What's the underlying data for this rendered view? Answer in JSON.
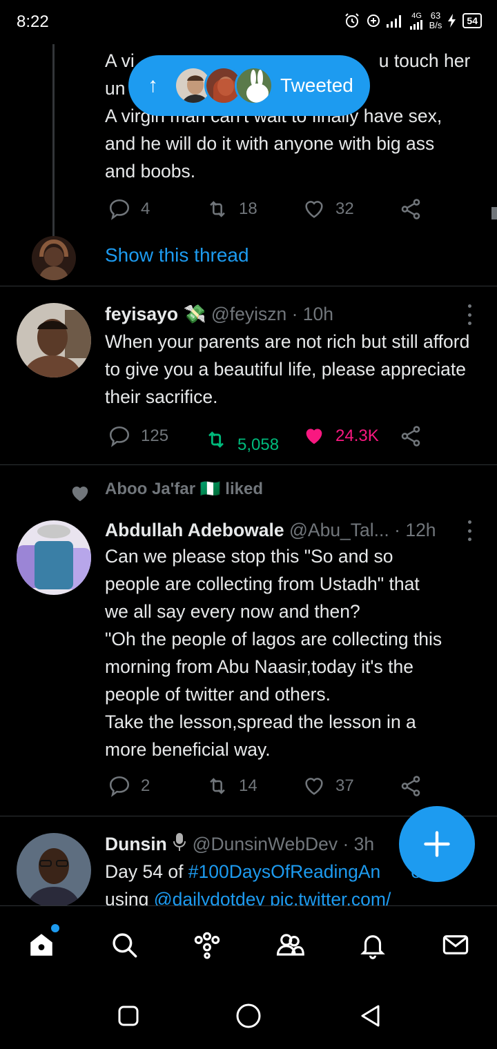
{
  "status_bar": {
    "time": "8:22",
    "network": "4G",
    "net_speed_value": "63",
    "net_speed_unit": "B/s",
    "battery": "54"
  },
  "toast": {
    "label": "Tweeted"
  },
  "thread_tweet": {
    "text_lines": [
      "A virgin woman will cry that you touch her",
      "un",
      "A virgin man can't wait to finally have sex,",
      "and he will do it with anyone with big ass",
      "and boobs."
    ],
    "text_line1_visible_start": "A vi",
    "text_line1_visible_end": "u touch her",
    "replies": "4",
    "retweets": "18",
    "likes": "32",
    "show_thread": "Show this thread"
  },
  "tweets": [
    {
      "name": "feyisayo",
      "name_emoji": "💸",
      "handle": "@feyiszn",
      "time": "· 10h",
      "text": "When your parents are not rich but still afford to give you a beautiful life, please appreciate their sacrifice.",
      "replies": "125",
      "retweets": "5,058",
      "likes": "24.3K"
    },
    {
      "social_context": "Aboo Ja'far 🇳🇬 liked",
      "name": "Abdullah Adebowale",
      "handle": "@Abu_Tal...",
      "time": "· 12h",
      "text_lines": [
        "Can we please stop this \"So and so",
        "people are collecting from Ustadh\" that",
        "we all say every now and then?",
        "\"Oh the people of lagos are collecting this",
        "morning from Abu Naasir,today it's the",
        "people of twitter and others.",
        "Take the lesson,spread the lesson in a",
        "more beneficial way."
      ],
      "replies": "2",
      "retweets": "14",
      "likes": "37"
    },
    {
      "name": "Dunsin",
      "handle": "@DunsinWebDev",
      "time": "· 3h",
      "text_prefix": "Day 54 of ",
      "hashtag": "#100DaysOfReadingAn",
      "hashtag_tail": "e",
      "line2_prefix": "using ",
      "mention": "@dailydotdev",
      "link": "pic.twitter.com/"
    }
  ],
  "colors": {
    "accent": "#1d9bf0",
    "retweet_active": "#00ba7c",
    "like_active": "#f91880",
    "muted": "#71767b"
  },
  "nav": [
    "home-icon",
    "search-icon",
    "spaces-icon",
    "communities-icon",
    "notifications-icon",
    "messages-icon"
  ]
}
